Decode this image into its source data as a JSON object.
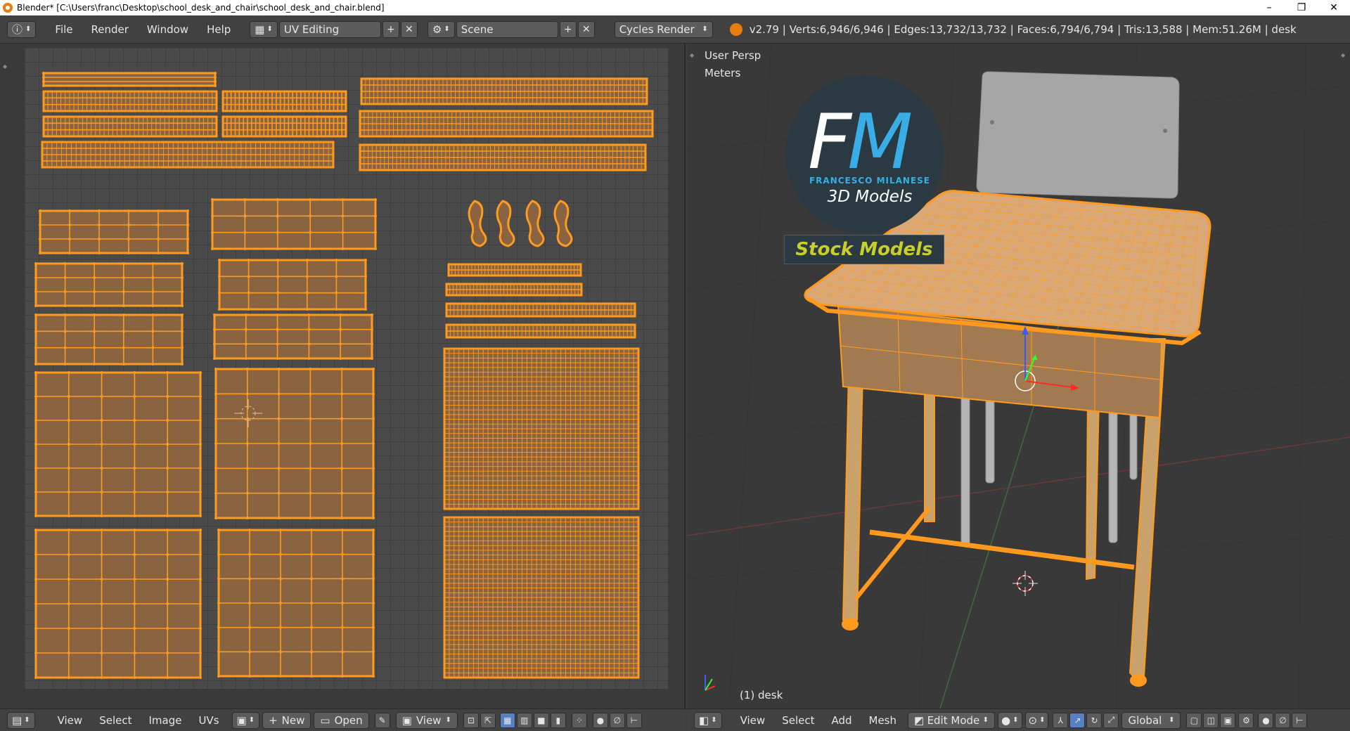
{
  "window": {
    "title": "Blender* [C:\\Users\\franc\\Desktop\\school_desk_and_chair\\school_desk_and_chair.blend]",
    "minimize": "–",
    "maximize": "❐",
    "close": "✕"
  },
  "top_header": {
    "menus": [
      "File",
      "Render",
      "Window",
      "Help"
    ],
    "layout": "UV Editing",
    "scene": "Scene",
    "engine": "Cycles Render",
    "stats": "v2.79 | Verts:6,946/6,946 | Edges:13,732/13,732 | Faces:6,794/6,794 | Tris:13,588 | Mem:51.26M | desk"
  },
  "uv_editor": {
    "menus": [
      "View",
      "Select",
      "Image",
      "UVs"
    ],
    "new_label": "New",
    "open_label": "Open",
    "view_label": "View"
  },
  "viewport": {
    "view_name": "User Persp",
    "units": "Meters",
    "object_label": "(1) desk",
    "menus": [
      "View",
      "Select",
      "Add",
      "Mesh"
    ],
    "mode": "Edit Mode",
    "orientation": "Global",
    "logo": {
      "letter_f": "F",
      "letter_m": "M",
      "name": "FRANCESCO MILANESE",
      "tagline": "3D Models",
      "banner": "Stock Models"
    }
  },
  "colors": {
    "uv_fill": "#8a6440",
    "uv_edge": "#ff9a1f",
    "accent_blue": "#39aee6",
    "banner_text": "#c8cf2a"
  }
}
